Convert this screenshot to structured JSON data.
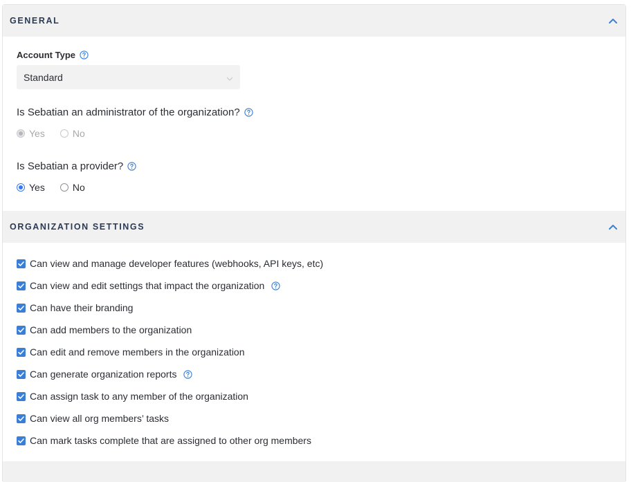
{
  "general": {
    "title": "GENERAL",
    "account_type_label": "Account Type",
    "account_type_value": "Standard",
    "admin_question": "Is Sebatian an administrator of the organization?",
    "admin_yes": "Yes",
    "admin_no": "No",
    "provider_question": "Is Sebatian a provider?",
    "provider_yes": "Yes",
    "provider_no": "No"
  },
  "org_settings": {
    "title": "ORGANIZATION SETTINGS",
    "items": [
      {
        "label": "Can view and manage developer features (webhooks, API keys, etc)",
        "checked": true,
        "help": false
      },
      {
        "label": "Can view and edit settings that impact the organization",
        "checked": true,
        "help": true
      },
      {
        "label": "Can have their branding",
        "checked": true,
        "help": false
      },
      {
        "label": "Can add members to the organization",
        "checked": true,
        "help": false
      },
      {
        "label": "Can edit and remove members in the organization",
        "checked": true,
        "help": false
      },
      {
        "label": "Can generate organization reports",
        "checked": true,
        "help": true
      },
      {
        "label": "Can assign task to any member of the organization",
        "checked": true,
        "help": false
      },
      {
        "label": "Can view all org members’ tasks",
        "checked": true,
        "help": false
      },
      {
        "label": "Can mark tasks complete that are assigned to other org members",
        "checked": true,
        "help": false
      }
    ]
  },
  "colors": {
    "accent": "#3478f6",
    "checkbox": "#3a7fd5",
    "header_bg": "#f1f1f2"
  },
  "icons": {
    "help": "question-circle-icon",
    "collapse": "chevron-up-icon",
    "dropdown": "chevron-down-icon",
    "check": "checkmark-icon"
  }
}
